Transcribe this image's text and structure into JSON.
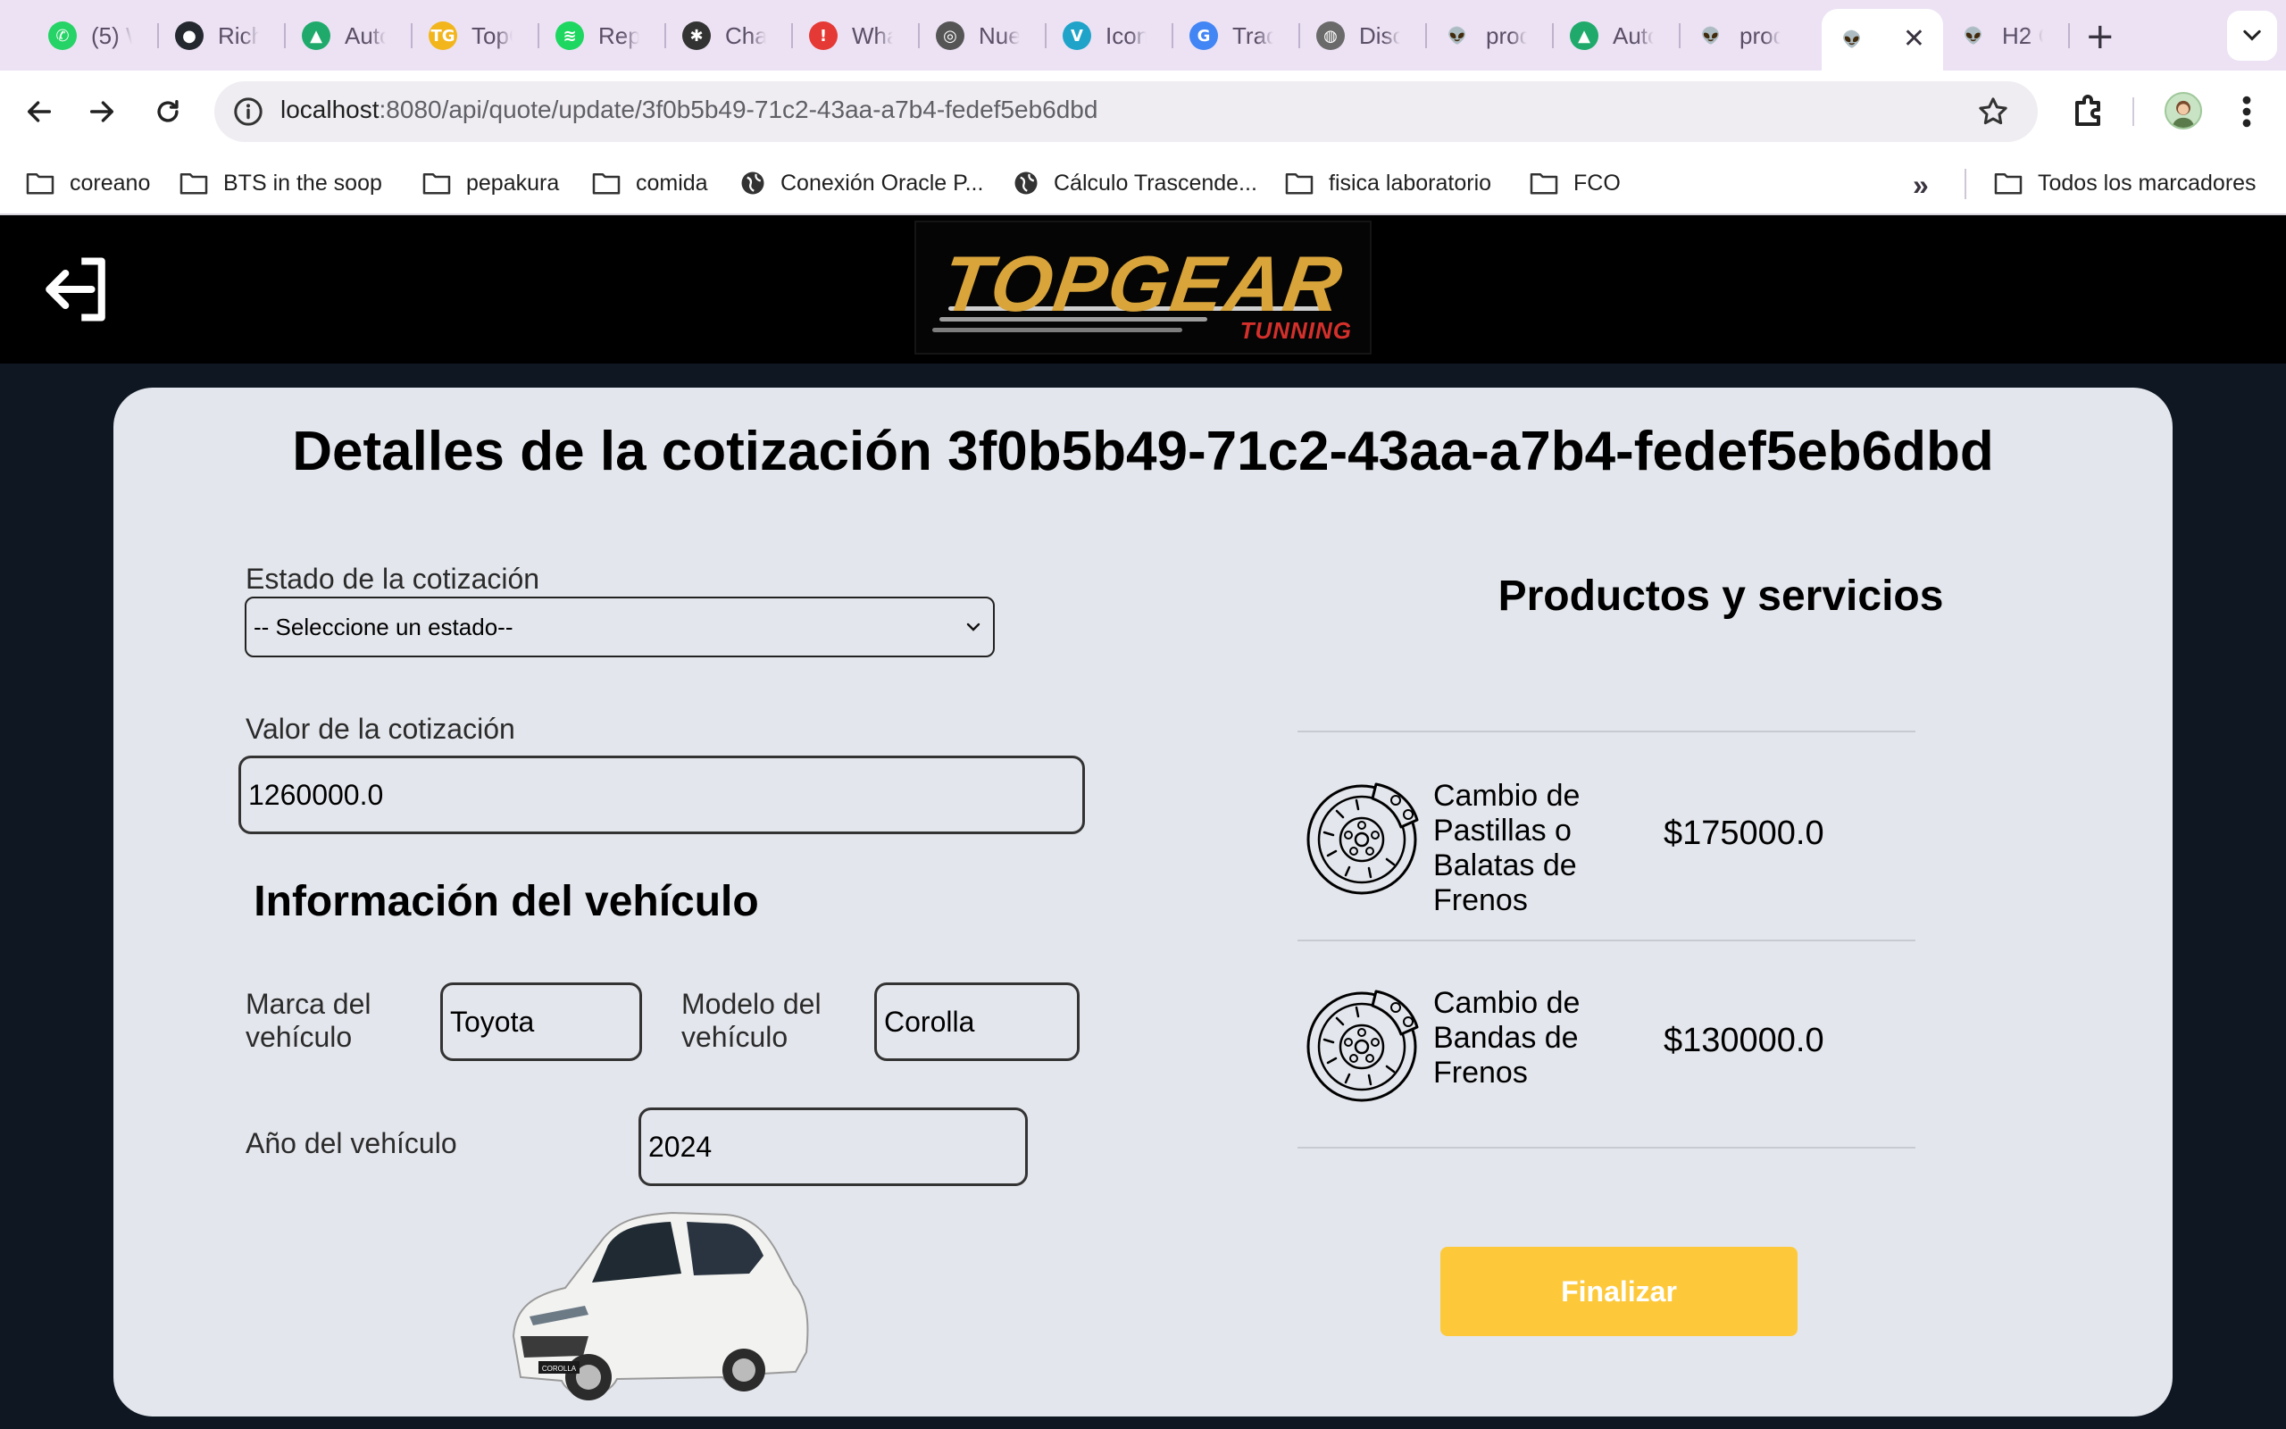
{
  "browser": {
    "tabs": [
      {
        "title": "(5) W",
        "icon": "whatsapp-icon",
        "color": "#25d366"
      },
      {
        "title": "Rich",
        "icon": "github-icon",
        "color": "#24292f"
      },
      {
        "title": "Auto",
        "icon": "triangle-app-icon",
        "color": "#1faa6b"
      },
      {
        "title": "TopG",
        "icon": "topgear-tg-icon",
        "color": "#f2b51c"
      },
      {
        "title": "Repr",
        "icon": "spotify-icon",
        "color": "#1ed760"
      },
      {
        "title": "Chat",
        "icon": "chatgpt-icon",
        "color": "#333333"
      },
      {
        "title": "Wha",
        "icon": "alert-icon",
        "color": "#e53935"
      },
      {
        "title": "Nue",
        "icon": "chrome-icon",
        "color": "#555555"
      },
      {
        "title": "Icon",
        "icon": "vuetify-icon",
        "color": "#1fa3c9"
      },
      {
        "title": "Trad",
        "icon": "translate-icon",
        "color": "#4285f4"
      },
      {
        "title": "Disc",
        "icon": "globe-icon",
        "color": "#6a6a6a"
      },
      {
        "title": "prod",
        "icon": "alien-icon",
        "color": "#3e3e3e"
      },
      {
        "title": "Auto",
        "icon": "triangle-app-icon",
        "color": "#1faa6b"
      },
      {
        "title": "prod",
        "icon": "alien-icon",
        "color": "#3e3e3e"
      },
      {
        "title": "",
        "icon": "alien-icon",
        "color": "#3e3e3e",
        "active": true
      },
      {
        "title": "H2 C",
        "icon": "alien-icon",
        "color": "#3e3e3e"
      }
    ],
    "active_tab_close": "✕",
    "new_tab": "+",
    "url_host": "localhost",
    "url_path": ":8080/api/quote/update/3f0b5b49-71c2-43aa-a7b4-fedef5eb6dbd",
    "bookmarks": [
      {
        "label": "coreano",
        "icon": "folder-icon"
      },
      {
        "label": "BTS in the soop",
        "icon": "folder-icon"
      },
      {
        "label": "pepakura",
        "icon": "folder-icon"
      },
      {
        "label": "comida",
        "icon": "folder-icon"
      },
      {
        "label": "Conexión Oracle P...",
        "icon": "globe-icon"
      },
      {
        "label": "Cálculo Trascende...",
        "icon": "globe-icon"
      },
      {
        "label": "fisica laboratorio",
        "icon": "folder-icon"
      },
      {
        "label": "FCO",
        "icon": "folder-icon"
      }
    ],
    "bookmarks_more": "»",
    "all_bookmarks": "Todos los marcadores"
  },
  "header": {
    "logo_main": "TOPGEAR",
    "logo_sub": "TUNNING"
  },
  "quote": {
    "title": "Detalles de la cotización 3f0b5b49-71c2-43aa-a7b4-fedef5eb6dbd",
    "status_label": "Estado de la cotización",
    "status_selected": "-- Seleccione un estado--",
    "value_label": "Valor de la cotización",
    "value": "1260000.0"
  },
  "vehicle": {
    "heading": "Información del vehículo",
    "brand_label": "Marca del vehículo",
    "brand": "Toyota",
    "model_label": "Modelo del vehículo",
    "model": "Corolla",
    "year_label": "Año del vehículo",
    "year": "2024",
    "image_badge": "COROLLA"
  },
  "products": {
    "heading": "Productos y servicios",
    "items": [
      {
        "name": "Cambio de Pastillas o Balatas de Frenos",
        "price": "$175000.0",
        "icon": "brake-disc-icon"
      },
      {
        "name": "Cambio de Bandas de Frenos",
        "price": "$130000.0",
        "icon": "brake-disc-icon"
      }
    ]
  },
  "actions": {
    "finish_label": "Finalizar",
    "finish_color": "#fdc93b"
  }
}
